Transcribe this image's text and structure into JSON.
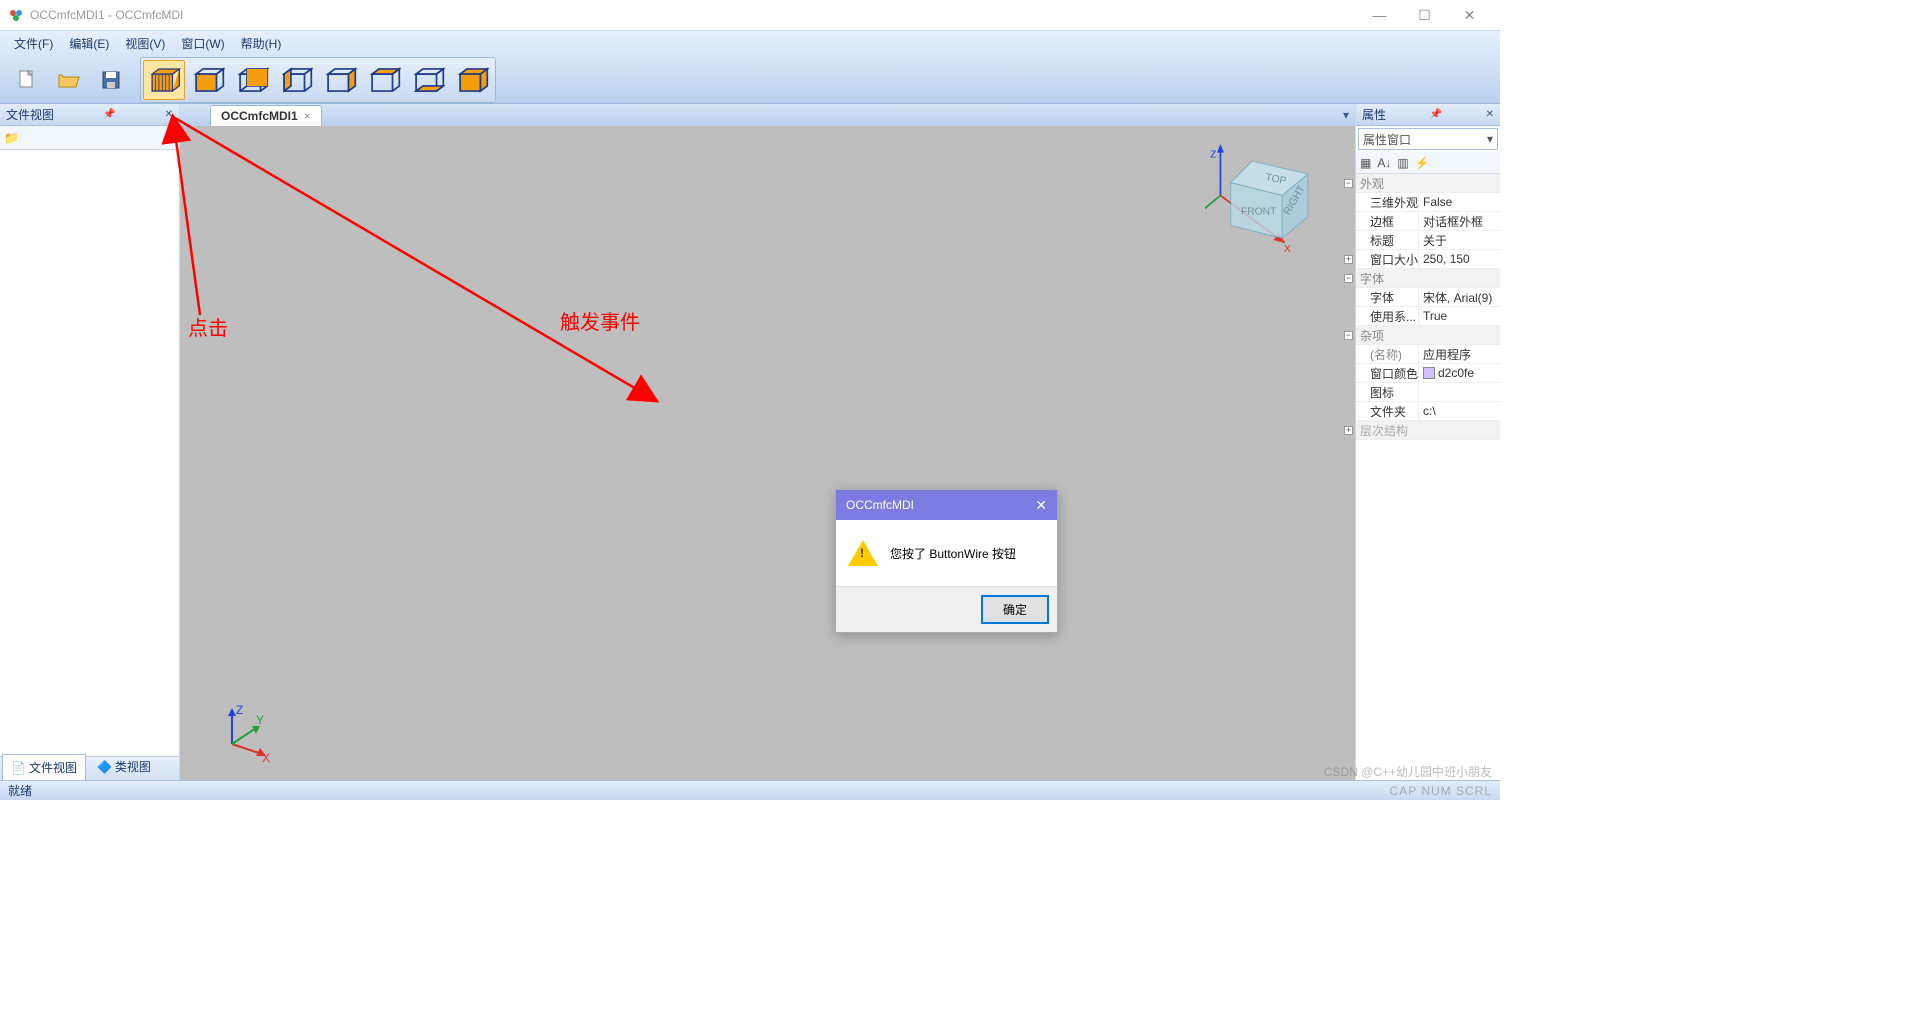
{
  "title": "OCCmfcMDI1 - OCCmfcMDI",
  "menu": {
    "file": "文件(F)",
    "edit": "编辑(E)",
    "view": "视图(V)",
    "window": "窗口(W)",
    "help": "帮助(H)"
  },
  "left_panel": {
    "title": "文件视图",
    "tab1": "文件视图",
    "tab2": "类视图"
  },
  "doc_tab": "OCCmfcMDI1",
  "nav_cube": {
    "top": "TOP",
    "front": "FRONT",
    "right": "RIGHT"
  },
  "axes": {
    "x": "X",
    "y": "Y",
    "z": "Z"
  },
  "msgbox": {
    "title": "OCCmfcMDI",
    "text": "您按了 ButtonWire 按钮",
    "ok": "确定"
  },
  "anno": {
    "click": "点击",
    "trigger": "触发事件"
  },
  "right_panel": {
    "title": "属性",
    "combo": "属性窗口",
    "groups": {
      "g1": "外观",
      "g2": "字体",
      "g3": "杂项",
      "g4": "层次结构"
    },
    "rows": {
      "r1k": "三维外观",
      "r1v": "False",
      "r2k": "边框",
      "r2v": "对话框外框",
      "r3k": "标题",
      "r3v": "关于",
      "r4k": "窗口大小",
      "r4v": "250, 150",
      "r5k": "字体",
      "r5v": "宋体, Arial(9)",
      "r6k": "使用系...",
      "r6v": "True",
      "r7k": "(名称)",
      "r7v": "应用程序",
      "r8k": "窗口颜色",
      "r8v": "d2c0fe",
      "r9k": "图标",
      "r9v": "",
      "r10k": "文件夹",
      "r10v": "c:\\"
    }
  },
  "status": {
    "ready": "就绪",
    "indicators": "CAP NUM SCRL"
  },
  "watermark": "CSDN @C++幼儿园中班小朋友"
}
